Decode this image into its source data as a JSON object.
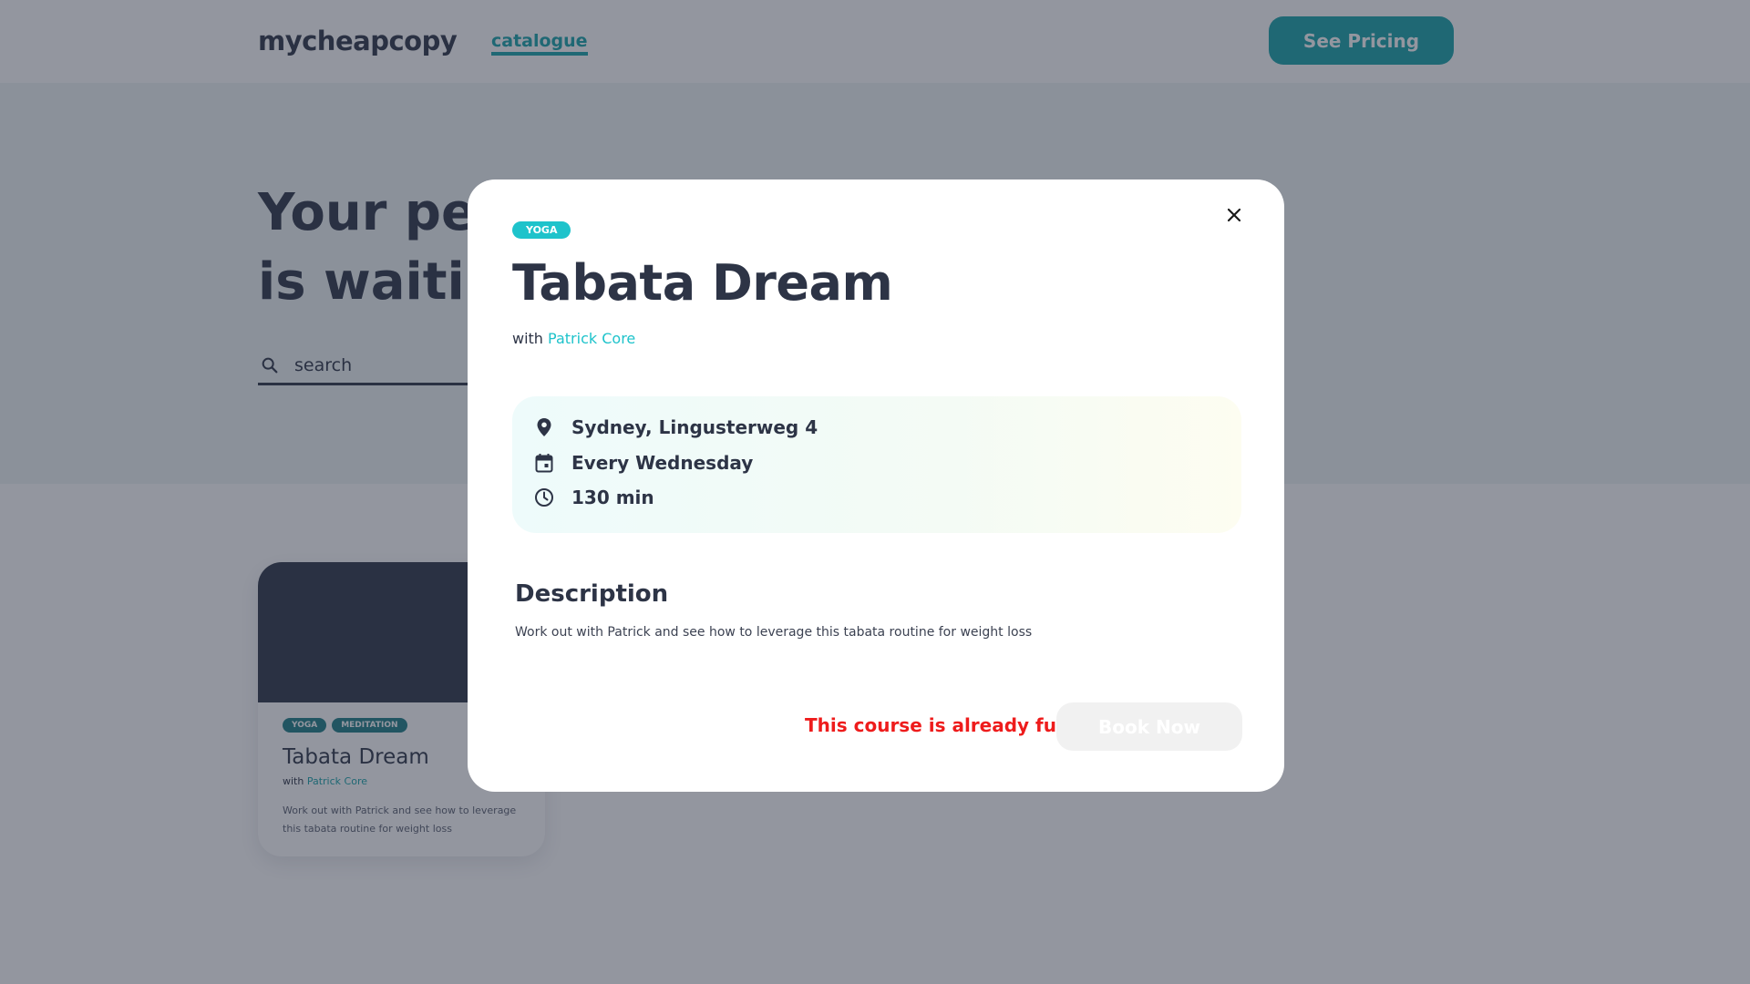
{
  "header": {
    "logo": "mycheapcopy",
    "nav_link": "catalogue",
    "pricing_button": "See Pricing"
  },
  "hero": {
    "title": "Your per\nis waitin",
    "search_placeholder": "search"
  },
  "card": {
    "tags": [
      "YOGA",
      "MEDITATION"
    ],
    "title": "Tabata Dream",
    "with_label": "with",
    "teacher": "Patrick Core",
    "description": "Work out with Patrick and see how to leverage this tabata routine for weight loss"
  },
  "modal": {
    "tag": "YOGA",
    "title": "Tabata Dream",
    "with_label": "with",
    "teacher": "Patrick Core",
    "location": "Sydney, Lingusterweg 4",
    "schedule": "Every Wednesday",
    "duration": "130 min",
    "description_heading": "Description",
    "description": "Work out with Patrick and see how to leverage this tabata routine for weight loss",
    "full_message": "This course is already full",
    "book_button": "Book Now"
  },
  "icons": {
    "search": "search-icon",
    "close": "close-icon",
    "location": "location-pin-icon",
    "schedule": "calendar-icon",
    "duration": "clock-icon"
  },
  "colors": {
    "accent": "#17a2a8",
    "tag": "#1ec3cb",
    "text": "#2d3446",
    "error": "#ee1c1c",
    "disabled_button": "#f1f1f1"
  }
}
